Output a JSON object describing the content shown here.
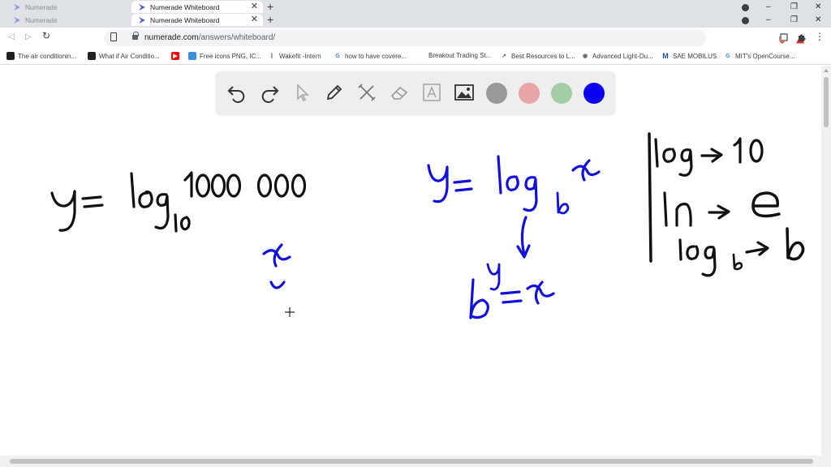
{
  "tabs": [
    {
      "title": "Numerade",
      "state": "inactive"
    },
    {
      "title": "Numerade",
      "state": "inactive"
    },
    {
      "title": "Numerade Whiteboard",
      "state": "active"
    },
    {
      "title": "Numerade Whiteboard",
      "state": "active"
    }
  ],
  "tab_close_glyph": "✕",
  "new_tab_glyph": "+",
  "window_controls": {
    "minimize": "–",
    "maximize": "❐",
    "close": "✕"
  },
  "address_bar": {
    "url_host": "numerade.com",
    "url_path": "/answers/whiteboard/"
  },
  "bookmarks": [
    {
      "label": "The air conditionin...",
      "icon": "bookmark-icon",
      "color": "#1a73e8"
    },
    {
      "label": "What if Air Conditio...",
      "icon": "generic-site-icon",
      "color": "#202124"
    },
    {
      "label": "",
      "icon": "youtube-icon",
      "color": "#ff0000"
    },
    {
      "label": "Free icons PNG, IC...",
      "icon": "flaticon-icon",
      "color": "#3e8ede"
    },
    {
      "label": "Wakefit -Intern",
      "icon": "wakefit-icon",
      "color": "#5f6368"
    },
    {
      "label": "how to have covere...",
      "icon": "google-icon",
      "color": "#4285f4"
    },
    {
      "label": "Breakout Trading St...",
      "icon": "",
      "color": ""
    },
    {
      "label": "Best Resources to L...",
      "icon": "link-icon",
      "color": "#5f6368"
    },
    {
      "label": "Advanced Light-Du...",
      "icon": "globe-icon",
      "color": "#5f6368"
    },
    {
      "label": "SAE MOBILUS",
      "icon": "sae-icon",
      "color": "#1a4b9b"
    },
    {
      "label": "MIT's OpenCourse...",
      "icon": "google-icon",
      "color": "#4285f4"
    }
  ],
  "whiteboard": {
    "tools": [
      "undo-icon",
      "redo-icon",
      "cursor-icon",
      "pen-icon",
      "tools-icon",
      "eraser-icon",
      "text-icon",
      "image-icon"
    ],
    "colors": [
      "#999999",
      "#e8a5a5",
      "#a3cea3",
      "#0b00f0"
    ],
    "ink_colors": {
      "black": "#111111",
      "blue": "#1010e0"
    }
  }
}
